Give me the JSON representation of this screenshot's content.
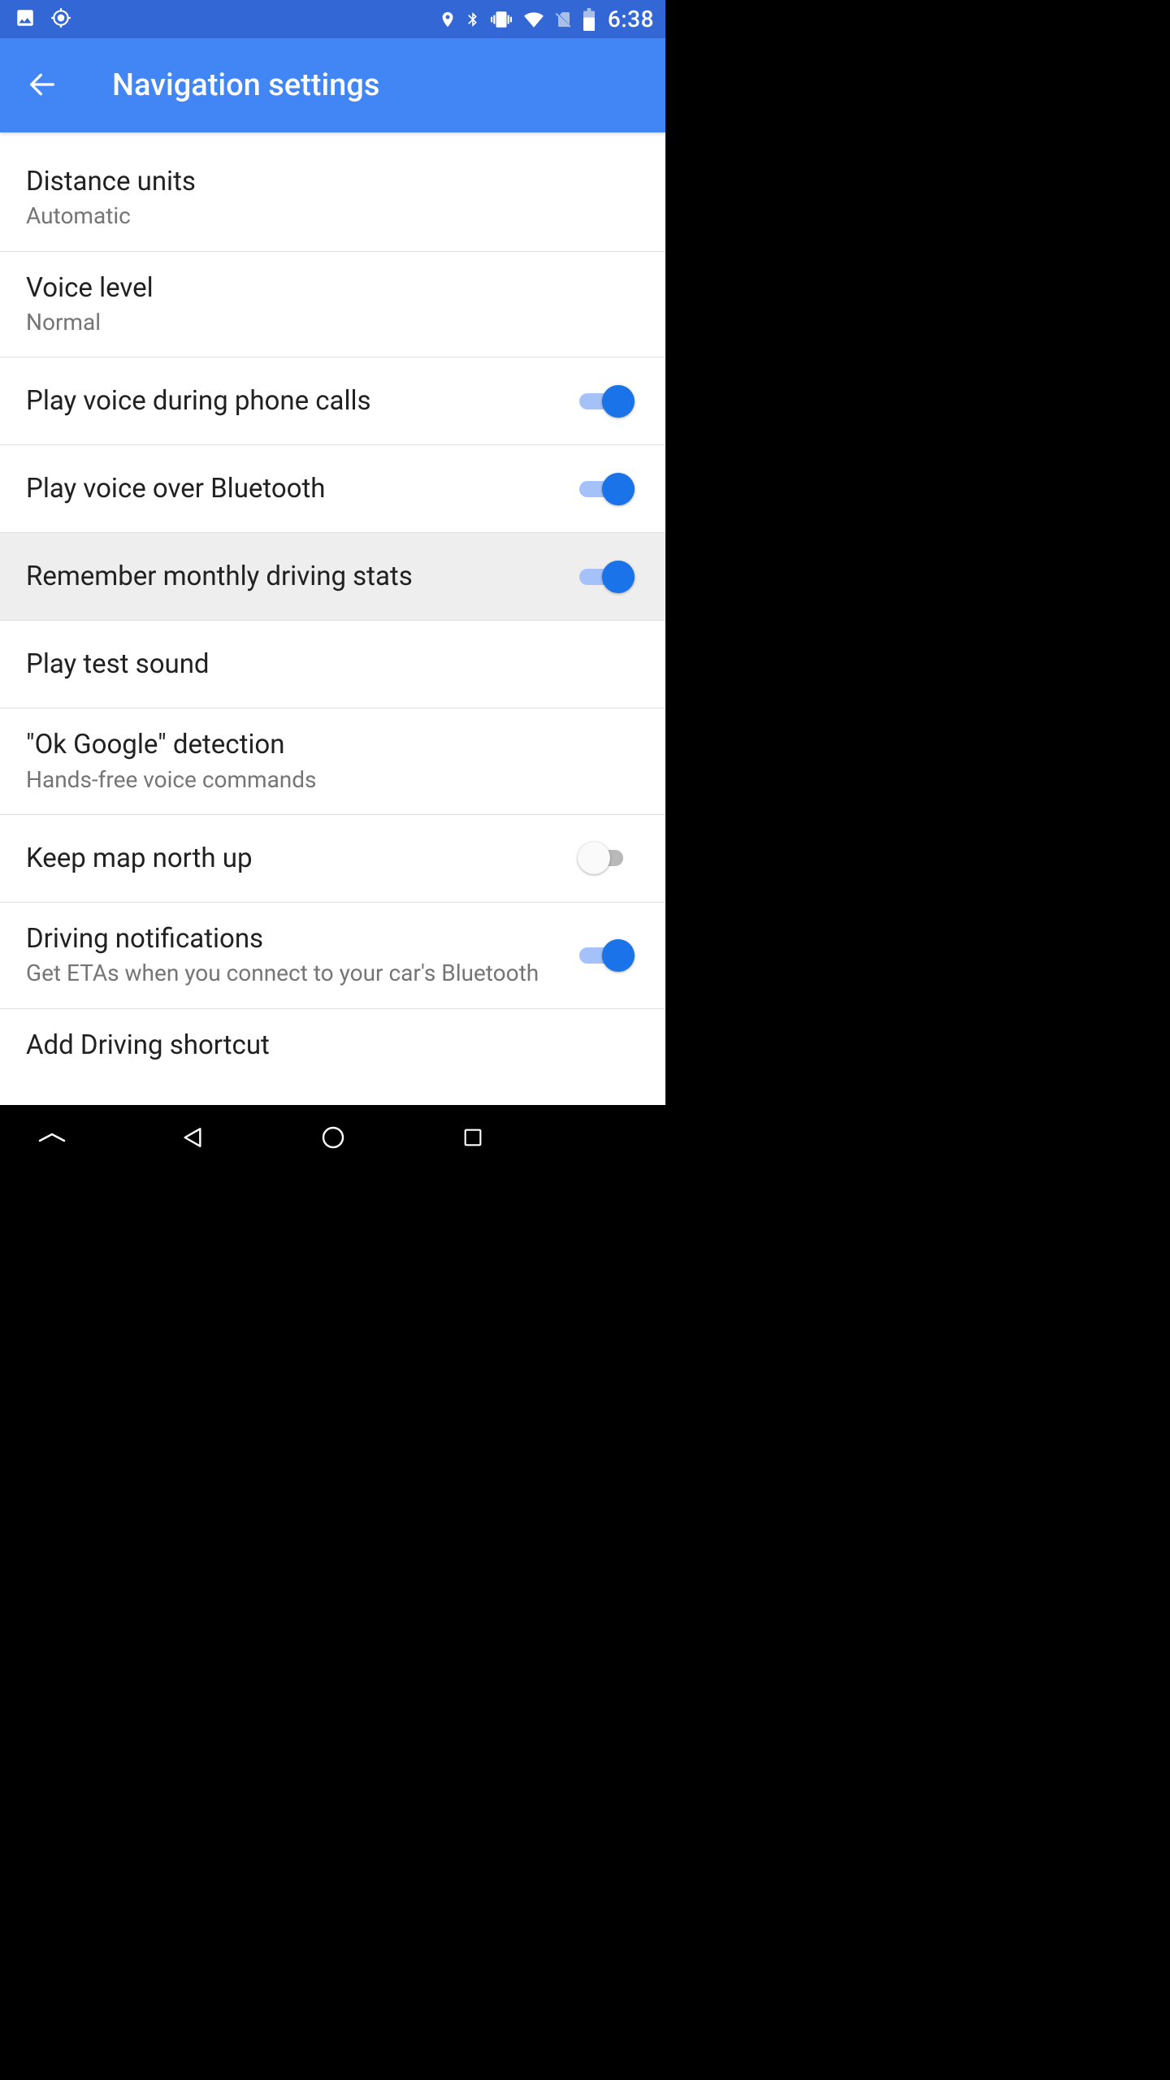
{
  "status_bar": {
    "time": "6:38",
    "left_icons": [
      "image-icon",
      "location-crosshair-icon"
    ],
    "right_icons": [
      "location-pin-icon",
      "bluetooth-icon",
      "vibrate-icon",
      "wifi-icon",
      "no-sim-icon",
      "battery-icon"
    ]
  },
  "app_bar": {
    "title": "Navigation settings",
    "back_icon": "arrow-back-icon"
  },
  "settings": [
    {
      "key": "distance_units",
      "title": "Distance units",
      "subtitle": "Automatic",
      "toggle": null,
      "highlight": false
    },
    {
      "key": "voice_level",
      "title": "Voice level",
      "subtitle": "Normal",
      "toggle": null,
      "highlight": false
    },
    {
      "key": "voice_calls",
      "title": "Play voice during phone calls",
      "subtitle": null,
      "toggle": true,
      "highlight": false
    },
    {
      "key": "voice_bt",
      "title": "Play voice over Bluetooth",
      "subtitle": null,
      "toggle": true,
      "highlight": false
    },
    {
      "key": "monthly_stats",
      "title": "Remember monthly driving stats",
      "subtitle": null,
      "toggle": true,
      "highlight": true
    },
    {
      "key": "test_sound",
      "title": "Play test sound",
      "subtitle": null,
      "toggle": null,
      "highlight": false
    },
    {
      "key": "ok_google",
      "title": "\"Ok Google\" detection",
      "subtitle": "Hands-free voice commands",
      "toggle": null,
      "highlight": false
    },
    {
      "key": "north_up",
      "title": "Keep map north up",
      "subtitle": null,
      "toggle": false,
      "highlight": false
    },
    {
      "key": "driving_notif",
      "title": "Driving notifications",
      "subtitle": "Get ETAs when you connect to your car's Bluetooth",
      "toggle": true,
      "highlight": false
    },
    {
      "key": "add_shortcut",
      "title": "Add Driving shortcut",
      "subtitle": null,
      "toggle": null,
      "highlight": false,
      "partial": true
    }
  ],
  "colors": {
    "status_bar_bg": "#3367d6",
    "app_bar_bg": "#4285f4",
    "switch_on_thumb": "#1a73e8",
    "switch_on_track": "#a4c2f9",
    "text_primary": "#212121",
    "text_secondary": "#757575"
  }
}
